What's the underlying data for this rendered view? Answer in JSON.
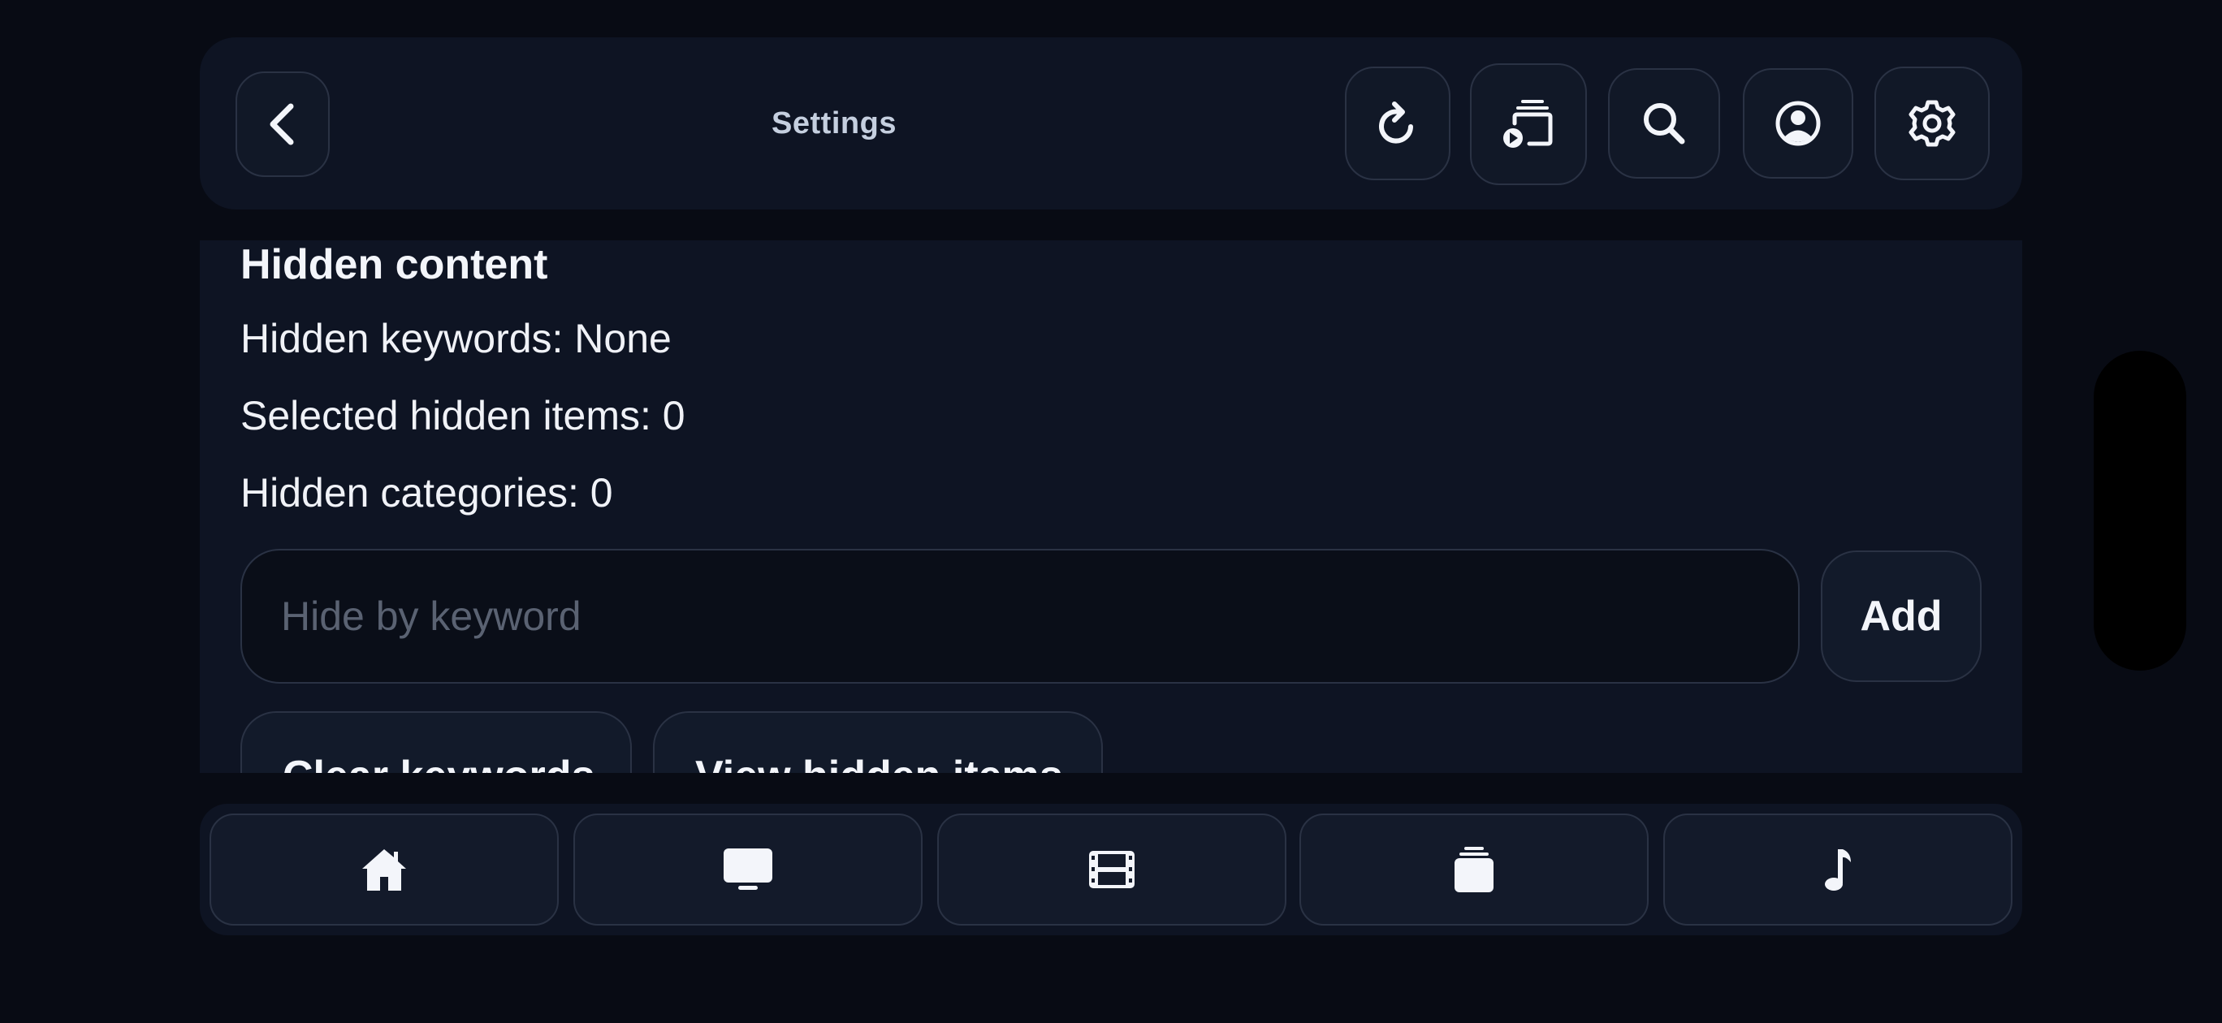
{
  "header": {
    "title": "Settings",
    "icons": {
      "back": "chevron-left-icon",
      "refresh": "refresh-icon",
      "cast": "cast-icon",
      "search": "search-icon",
      "profile": "user-circle-icon",
      "settings": "gear-icon"
    }
  },
  "hidden_content": {
    "title": "Hidden content",
    "keywords_line": "Hidden keywords: None",
    "items_line": "Selected hidden items: 0",
    "categories_line": "Hidden categories: 0",
    "keyword_input": {
      "placeholder": "Hide by keyword",
      "value": ""
    },
    "add_label": "Add",
    "clear_label": "Clear keywords",
    "view_label": "View hidden items"
  },
  "bottom_nav": {
    "items": [
      {
        "name": "home",
        "icon": "home-icon"
      },
      {
        "name": "tv",
        "icon": "tv-icon"
      },
      {
        "name": "movies",
        "icon": "film-icon"
      },
      {
        "name": "collections",
        "icon": "stack-icon"
      },
      {
        "name": "music",
        "icon": "music-note-icon"
      }
    ]
  },
  "colors": {
    "background": "#080b14",
    "panel": "#0e1423",
    "border": "#2a3244",
    "text": "#f0f2f7",
    "muted": "#5a6272"
  }
}
